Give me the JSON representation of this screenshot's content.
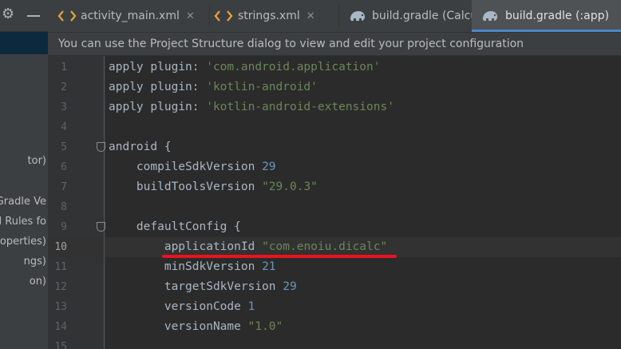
{
  "left_panel": {
    "items": [
      "tor)",
      "Gradle Ve",
      "d Rules fo",
      "operties)",
      "ngs)",
      "on)"
    ]
  },
  "tabs": [
    {
      "label": "activity_main.xml",
      "icon": "xml-file-icon",
      "active": false
    },
    {
      "label": "strings.xml",
      "icon": "xml-file-icon",
      "active": false
    },
    {
      "label": "build.gradle (Calculator)",
      "icon": "gradle-elephant-icon",
      "active": false
    },
    {
      "label": "build.gradle (:app)",
      "icon": "gradle-elephant-icon",
      "active": true
    }
  ],
  "notification": {
    "text": "You can use the Project Structure dialog to view and edit your project configuration"
  },
  "editor": {
    "current_line": 10,
    "line_numbers": [
      "1",
      "2",
      "3",
      "4",
      "5",
      "6",
      "7",
      "8",
      "9",
      "10",
      "11",
      "12",
      "13",
      "14",
      "15"
    ],
    "lines": [
      [
        {
          "t": "apply plugin: ",
          "c": "kw"
        },
        {
          "t": "'com.android.application'",
          "c": "str"
        }
      ],
      [
        {
          "t": "apply plugin: ",
          "c": "kw"
        },
        {
          "t": "'kotlin-android'",
          "c": "str"
        }
      ],
      [
        {
          "t": "apply plugin: ",
          "c": "kw"
        },
        {
          "t": "'kotlin-android-extensions'",
          "c": "str"
        }
      ],
      [],
      [
        {
          "t": "android {",
          "c": "kw"
        }
      ],
      [
        {
          "t": "    compileSdkVersion ",
          "c": "kw"
        },
        {
          "t": "29",
          "c": "num"
        }
      ],
      [
        {
          "t": "    buildToolsVersion ",
          "c": "kw"
        },
        {
          "t": "\"29.0.3\"",
          "c": "str"
        }
      ],
      [],
      [
        {
          "t": "    defaultConfig {",
          "c": "kw"
        }
      ],
      [
        {
          "t": "        applicationId ",
          "c": "kw"
        },
        {
          "t": "\"com.enoiu.dicalc\"",
          "c": "str"
        }
      ],
      [
        {
          "t": "        minSdkVersion ",
          "c": "kw"
        },
        {
          "t": "21",
          "c": "num"
        }
      ],
      [
        {
          "t": "        targetSdkVersion ",
          "c": "kw"
        },
        {
          "t": "29",
          "c": "num"
        }
      ],
      [
        {
          "t": "        versionCode ",
          "c": "kw"
        },
        {
          "t": "1",
          "c": "num"
        }
      ],
      [
        {
          "t": "        versionName ",
          "c": "kw"
        },
        {
          "t": "\"1.0\"",
          "c": "str"
        }
      ],
      []
    ]
  },
  "colors": {
    "string": "#6a8759",
    "number": "#6897bb",
    "plain": "#a9b7c6",
    "highlight_underline": "#e8141c"
  }
}
